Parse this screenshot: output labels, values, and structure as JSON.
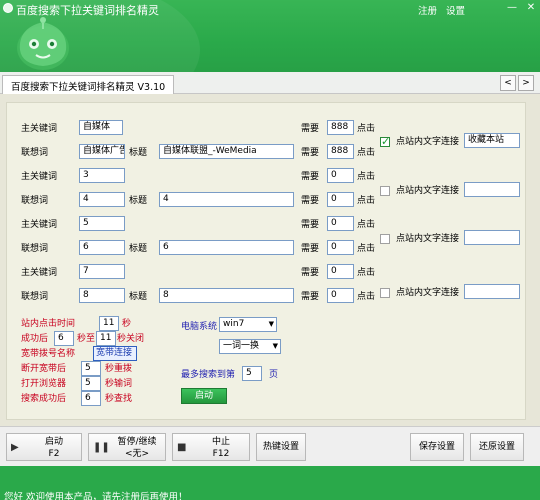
{
  "titlebar": {
    "app_title": "百度搜索下拉关键词排名精灵",
    "register": "注册",
    "settings": "设置",
    "minimize": "—",
    "close": "✕"
  },
  "tab": {
    "label": "百度搜索下拉关键词排名精灵 V3.10",
    "prev": "<",
    "next": ">"
  },
  "labels": {
    "main_kw": "主关键词",
    "assoc": "联想词",
    "title": "标题",
    "need": "需要",
    "click": "点击",
    "site_link": "点站内文字连接"
  },
  "groups": [
    {
      "main": "自媒体",
      "assoc": "自媒体广告",
      "title": "自媒体联盟_-WeMedia",
      "need_main": "888",
      "need_assoc": "888",
      "checked": true,
      "link": "收藏本站"
    },
    {
      "main": "3",
      "assoc": "4",
      "title": "4",
      "need_main": "0",
      "need_assoc": "0",
      "checked": false,
      "link": ""
    },
    {
      "main": "5",
      "assoc": "6",
      "title": "6",
      "need_main": "0",
      "need_assoc": "0",
      "checked": false,
      "link": ""
    },
    {
      "main": "7",
      "assoc": "8",
      "title": "8",
      "need_main": "0",
      "need_assoc": "0",
      "checked": false,
      "link": ""
    }
  ],
  "settings": {
    "click_time_label": "站内点击时间",
    "click_time_value": "11",
    "click_time_unit": "秒",
    "success_label": "成功后",
    "success_from": "6",
    "success_mid": "秒至",
    "success_to": "11",
    "success_unit": "秒关闭",
    "broadband_label": "宽带拨号名称",
    "broadband_button": "宽带连接",
    "disconnect_label": "断开宽带后",
    "disconnect_value": "5",
    "disconnect_unit": "秒重拨",
    "browser_label": "打开浏览器",
    "browser_value": "5",
    "browser_unit": "秒输词",
    "search_success_label": "搜索成功后",
    "search_success_value": "6",
    "search_success_unit": "秒查找",
    "os_label": "电脑系统",
    "os_value": "win7",
    "mode_value": "一词一换",
    "max_search_label": "最多搜索到第",
    "max_search_value": "5",
    "max_search_unit": "页",
    "start_button": "启动"
  },
  "toolbar": {
    "start": "启动",
    "start_key": "F2",
    "pause": "暂停/继续",
    "pause_key": "<无>",
    "stop": "中止",
    "stop_key": "F12",
    "hotkey": "热键设置",
    "save": "保存设置",
    "restore": "还原设置"
  },
  "status": {
    "message": "您好 欢迎使用本产品，请先注册后再使用！"
  },
  "colors": {
    "brand_green": "#2aa94a",
    "panel_bg": "#f1f1e3",
    "red_label": "#c8001e"
  }
}
